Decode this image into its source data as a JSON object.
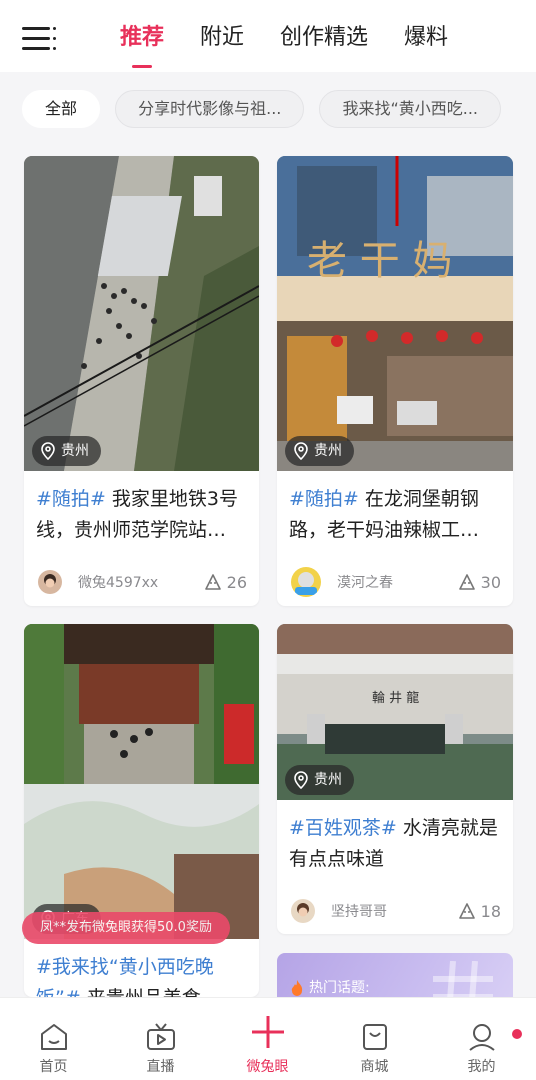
{
  "header": {
    "tabs": [
      {
        "label": "推荐",
        "active": true
      },
      {
        "label": "附近",
        "active": false
      },
      {
        "label": "创作精选",
        "active": false
      },
      {
        "label": "爆料",
        "active": false
      }
    ]
  },
  "filters": [
    {
      "label": "全部",
      "active": true
    },
    {
      "label": "分享时代影像与祖...",
      "active": false
    },
    {
      "label": "我来找“黄小西吃...",
      "active": false
    }
  ],
  "posts": [
    {
      "location": "贵州",
      "tag": "#随拍#",
      "text": " 我家里地铁3号线，贵州师范学院站…",
      "user": "微兔4597xx",
      "likes": "26"
    },
    {
      "location": "贵州",
      "tag": "#随拍#",
      "text": " 在龙洞堡朝钢路，老干妈油辣椒工…",
      "user": "漠河之春",
      "likes": "30"
    },
    {
      "location": "广东",
      "tag": "#我来找“黄小西吃晚饭”#",
      "text": " 来贵州品美食…",
      "user": "",
      "likes": ""
    },
    {
      "location": "贵州",
      "tag": "#百姓观茶#",
      "text": " 水清亮就是有点点味道",
      "user": "坚持哥哥",
      "likes": "18"
    }
  ],
  "toast": "凤**发布微兔眼获得50.0奖励",
  "hot_topics_label": "热门话题:",
  "bottom_nav": [
    {
      "label": "首页",
      "icon": "home-icon",
      "active": false
    },
    {
      "label": "直播",
      "icon": "tv-icon",
      "active": false
    },
    {
      "label": "微兔眼",
      "icon": "plus-icon",
      "active": true
    },
    {
      "label": "商城",
      "icon": "shop-bag-icon",
      "active": false
    },
    {
      "label": "我的",
      "icon": "profile-icon",
      "active": false
    }
  ],
  "colors": {
    "accent": "#e8305a",
    "tag": "#3f7fd1",
    "toast": "#ea4a6a"
  }
}
